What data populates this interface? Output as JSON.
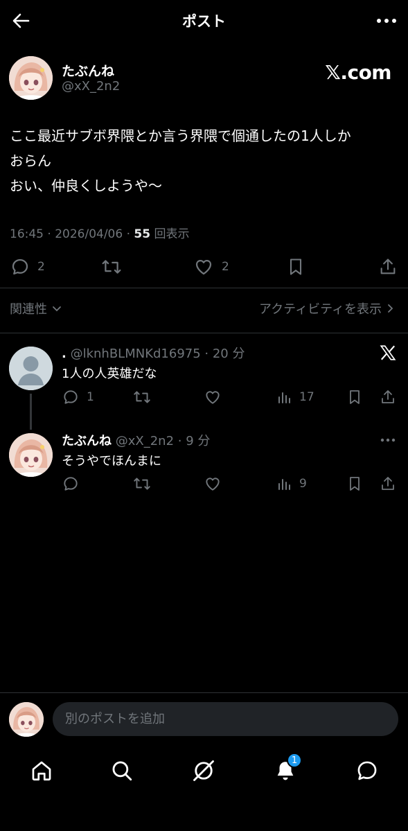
{
  "header": {
    "title": "ポスト",
    "back_icon": "back-arrow-icon",
    "more_icon": "more-horizontal-icon"
  },
  "post": {
    "author": {
      "name": "たぶんね",
      "handle": "@xX_2n2"
    },
    "brand": "𝕏.com",
    "text": "ここ最近サブボ界隈とか言う界隈で個通したの1人しか\nおらん\nおい、仲良くしようや〜",
    "time": "16:45 · 2026/04/06 · ",
    "views_count": "55",
    "views_label": " 回表示",
    "actions": {
      "reply_count": "2",
      "retweet_count": "",
      "like_count": "2"
    }
  },
  "filters": {
    "relevance": "関連性",
    "activity": "アクティビティを表示"
  },
  "replies": [
    {
      "name": ".",
      "handle": "@lknhBLMNKd16975",
      "time": " · 20 分",
      "text": "1人の人英雄だな",
      "reply_count": "1",
      "views": "17"
    },
    {
      "name": "たぶんね",
      "handle": "@xX_2n2",
      "time": " · 9 分",
      "text": "そうやでほんまに",
      "reply_count": "",
      "views": "9"
    }
  ],
  "composer": {
    "placeholder": "別のポストを追加"
  },
  "nav": {
    "notification_badge": "1"
  },
  "colors": {
    "background": "#000000",
    "text": "#e7e9ea",
    "muted": "#71767b",
    "accent": "#1d9bf0"
  }
}
